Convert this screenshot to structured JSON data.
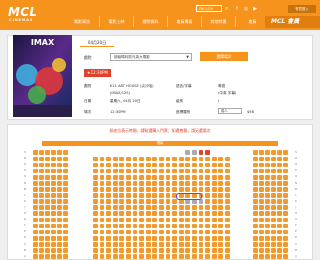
{
  "header": {
    "logo": "MCL",
    "logo_sub": "CINEMAS",
    "nav": [
      "電影資訊",
      "電影上映",
      "戲院資料",
      "會員專區",
      "其他特惠",
      "會員"
    ],
    "lang_label": "ENGLISH",
    "member_label": "MCL 會員",
    "member_login": "會員登入",
    "social": [
      "facebook-icon",
      "instagram-icon",
      "youtube-icon"
    ]
  },
  "movie": {
    "poster_title": "IMAX",
    "date_tab": "04月20日",
    "cinema_label": "戲院",
    "cinema_value": "超級瑪利歐兄弟大電影",
    "cta_label": "選擇場次",
    "time": "★12:30PM",
    "info": [
      {
        "k": "戲院",
        "v": "K11 ART HOUSE (尖沙咀)"
      },
      {
        "k": "",
        "v": "(IMAX/12S)"
      },
      {
        "k": "日期",
        "v": "星期六, 04月 20日"
      },
      {
        "k": "場次",
        "v": "12:30PM"
      }
    ],
    "info_right": [
      {
        "k": "語言/字幕",
        "v": "粵語"
      },
      {
        "k": "",
        "v": "(中英 字幕)"
      },
      {
        "k": "級別",
        "v": "I"
      },
      {
        "k": "座標類別",
        "v": "成人"
      }
    ],
    "price": "$98"
  },
  "seatmap": {
    "notice": "如座位表示時間，請點選購入門票；如遇售罄，請另選場次",
    "screen_label": "銀幕",
    "row_labels": [
      "S",
      "R",
      "Q",
      "P",
      "O",
      "N",
      "M",
      "L",
      "K",
      "J",
      "H",
      "G",
      "F",
      "E",
      "D",
      "C",
      "B",
      "A"
    ]
  },
  "colors": {
    "brand": "#f6931d",
    "seat_available": "#f39a2c",
    "seat_taken": "#aaaaaa",
    "seat_selected": "#e0412b"
  }
}
